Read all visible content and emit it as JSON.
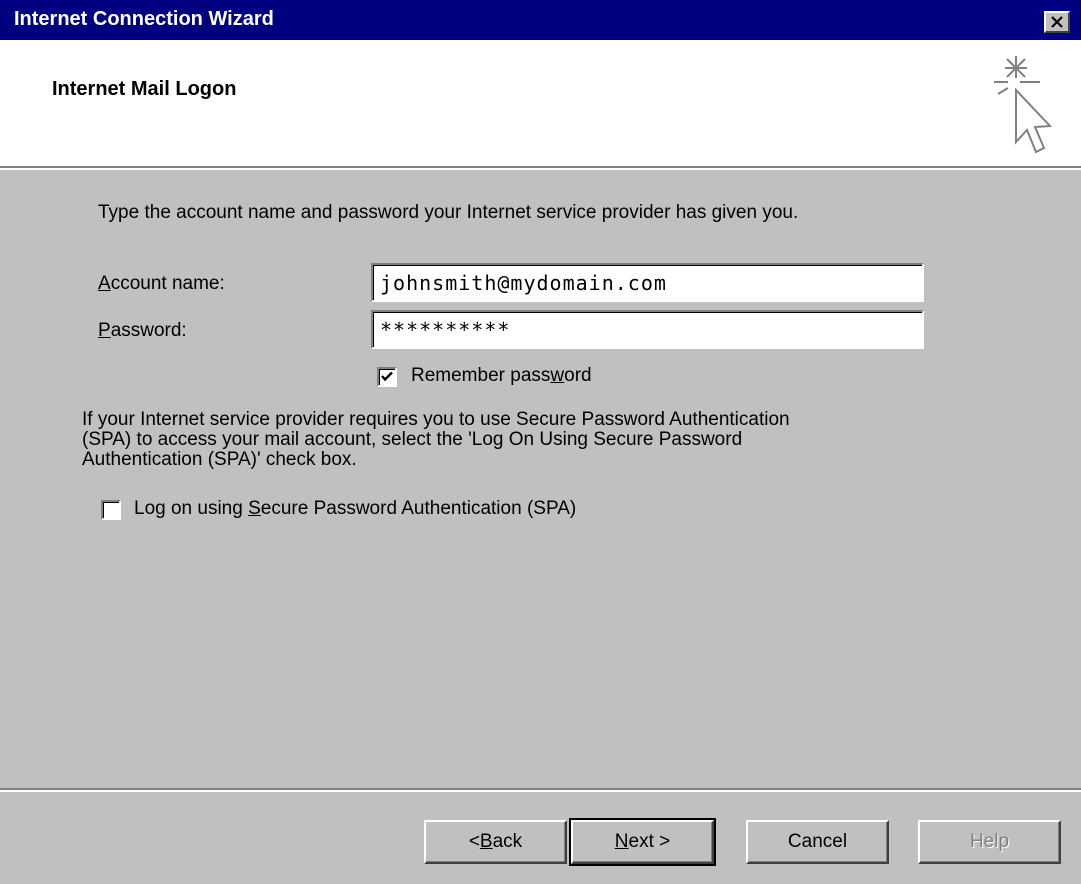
{
  "window": {
    "title": "Internet Connection Wizard"
  },
  "header": {
    "title": "Internet Mail Logon"
  },
  "form": {
    "intro": "Type the account name and password your Internet service provider has given you.",
    "account_label": "Account name:",
    "account_value": "johnsmith@mydomain.com",
    "password_label": "Password:",
    "password_value": "**********",
    "remember_label": "Remember password",
    "remember_checked": true,
    "spa_text_1": "If your Internet service provider requires you to use Secure Password Authentication",
    "spa_text_2": "(SPA) to access your mail account, select the 'Log On Using Secure Password",
    "spa_text_3": "Authentication (SPA)' check box.",
    "spa_label": "Log on using Secure Password Authentication (SPA)",
    "spa_checked": false
  },
  "buttons": {
    "back": "< Back",
    "next": "Next >",
    "cancel": "Cancel",
    "help": "Help"
  },
  "colors": {
    "titlebar": "#000080",
    "face": "#c0c0c0"
  }
}
